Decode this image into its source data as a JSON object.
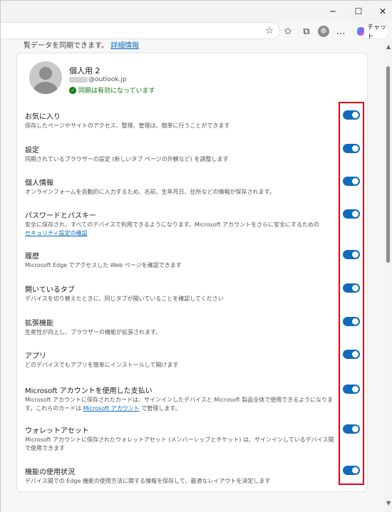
{
  "window": {
    "minimize": "─",
    "maximize": "☐",
    "close": "✕"
  },
  "toolbar": {
    "chat_label": "チャット"
  },
  "intro": {
    "text": "覧データを同期できます。",
    "link": "詳細情報"
  },
  "profile": {
    "name": "個人用 2",
    "email_domain": "@outlook.jp",
    "status": "同期は有効になっています"
  },
  "items": [
    {
      "title": "お気に入り",
      "desc": "保存したページやサイトのアクセス、整理、管理は、簡単に行うことができます",
      "on": true
    },
    {
      "title": "設定",
      "desc": "同期されているブラウザーの設定 (新しいタブ ページの外観など) を調整します",
      "on": true
    },
    {
      "title": "個人情報",
      "desc": "オンラインフォームを自動的に入力するため、名前、生年月日、住所などの情報が保存されます。",
      "on": true
    },
    {
      "title": "パスワードとパスキー",
      "desc": "安全に保存され、すべてのデバイスで利用できるようになります。Microsoft アカウントをさらに安全にするための",
      "link": "セキュリティ設定の確認",
      "on": true
    },
    {
      "title": "履歴",
      "desc": "Microsoft Edge でアクセスした Web ページを確認できます",
      "on": true
    },
    {
      "title": "開いているタブ",
      "desc": "デバイスを切り替えたときに、同じタブが開いていることを確認してください",
      "on": true
    },
    {
      "title": "拡張機能",
      "desc": "生産性が向上し、ブラウザーの機能が拡張されます。",
      "on": true
    },
    {
      "title": "アプリ",
      "desc": "どのデバイスでもアプリを簡単にインストールして開けます",
      "on": true
    },
    {
      "title": "Microsoft アカウントを使用した支払い",
      "desc": "Microsoft アカウントに保存されたカードは、サインインしたデバイスと Microsoft 製品全体で使用できるようになります。これらのカードは",
      "link": "Microsoft アカウント",
      "desc_after": " で管理します。",
      "on": true
    },
    {
      "title": "ウォレットアセット",
      "desc": "Microsoft アカウントに保存されたウォレットアセット (メンバーシップとチケット) は、サインインしているデバイス間で使用できます",
      "on": true
    },
    {
      "title": "機能の使用状況",
      "desc": "デバイス間での Edge 機能の使用方法に関する情報を保存して、最適なレイアウトを決定します",
      "on": true
    }
  ],
  "colors": {
    "accent": "#0f6cbd",
    "highlight": "#e60012",
    "status_green": "#107c10"
  }
}
